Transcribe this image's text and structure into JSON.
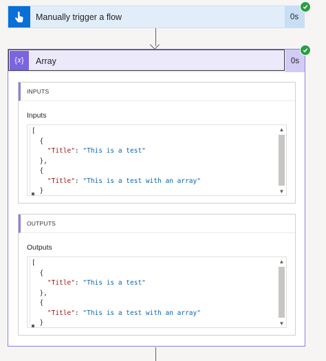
{
  "trigger": {
    "title": "Manually trigger a flow",
    "duration": "0s",
    "icon": "touch-hand-icon",
    "status": "succeeded"
  },
  "action": {
    "title": "Array",
    "duration": "0s",
    "icon": "variable-braces-icon",
    "icon_glyph": "{𝑥}",
    "status": "succeeded"
  },
  "inputs": {
    "section_title": "INPUTS",
    "label": "Inputs",
    "lines": [
      [
        {
          "t": "p",
          "v": "["
        }
      ],
      [
        {
          "t": "p",
          "v": "  {"
        }
      ],
      [
        {
          "t": "k",
          "v": "    \"Title\""
        },
        {
          "t": "p",
          "v": ": "
        },
        {
          "t": "s",
          "v": "\"This is a test\""
        }
      ],
      [
        {
          "t": "p",
          "v": "  },"
        }
      ],
      [
        {
          "t": "p",
          "v": "  {"
        }
      ],
      [
        {
          "t": "k",
          "v": "    \"Title\""
        },
        {
          "t": "p",
          "v": ": "
        },
        {
          "t": "s",
          "v": "\"This is a test with an array\""
        }
      ],
      [
        {
          "t": "p",
          "v": "  }"
        }
      ],
      [
        {
          "t": "p",
          "v": "]"
        }
      ]
    ]
  },
  "outputs": {
    "section_title": "OUTPUTS",
    "label": "Outputs",
    "lines": [
      [
        {
          "t": "p",
          "v": "["
        }
      ],
      [
        {
          "t": "p",
          "v": "  {"
        }
      ],
      [
        {
          "t": "k",
          "v": "    \"Title\""
        },
        {
          "t": "p",
          "v": ": "
        },
        {
          "t": "s",
          "v": "\"This is a test\""
        }
      ],
      [
        {
          "t": "p",
          "v": "  },"
        }
      ],
      [
        {
          "t": "p",
          "v": "  {"
        }
      ],
      [
        {
          "t": "k",
          "v": "    \"Title\""
        },
        {
          "t": "p",
          "v": ": "
        },
        {
          "t": "s",
          "v": "\"This is a test with an array\""
        }
      ],
      [
        {
          "t": "p",
          "v": "  }"
        }
      ],
      [
        {
          "t": "p",
          "v": "]"
        }
      ]
    ]
  },
  "colors": {
    "trigger_accent": "#0a6fd6",
    "action_accent": "#7b64e0",
    "success": "#2a9f43",
    "json_key": "#a31515",
    "json_string": "#0b63b5"
  }
}
